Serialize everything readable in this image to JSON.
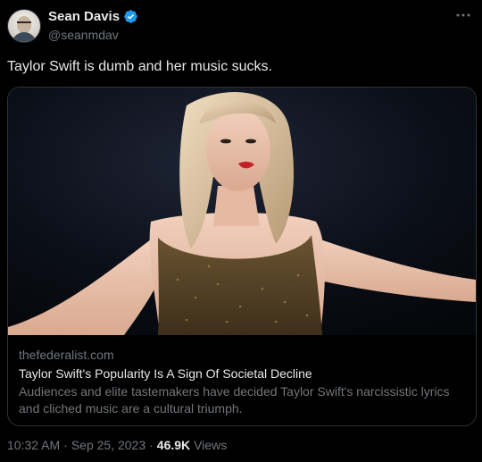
{
  "author": {
    "display_name": "Sean Davis",
    "handle": "@seanmdav",
    "verified_color": "#1d9bf0"
  },
  "menu": {
    "icon": "more-icon"
  },
  "tweet": {
    "text": "Taylor Swift is dumb and her music sucks."
  },
  "card": {
    "domain": "thefederalist.com",
    "title": "Taylor Swift's Popularity Is A Sign Of Societal Decline",
    "description": "Audiences and elite tastemakers have decided Taylor Swift's narcissistic lyrics and cliched music are a cultural triumph."
  },
  "meta": {
    "time": "10:32 AM",
    "separator": "·",
    "date": "Sep 25, 2023",
    "views_count": "46.9K",
    "views_label": "Views"
  },
  "colors": {
    "background": "#000000",
    "text_primary": "#e7e9ea",
    "text_secondary": "#71767b",
    "border": "#2f3336"
  }
}
